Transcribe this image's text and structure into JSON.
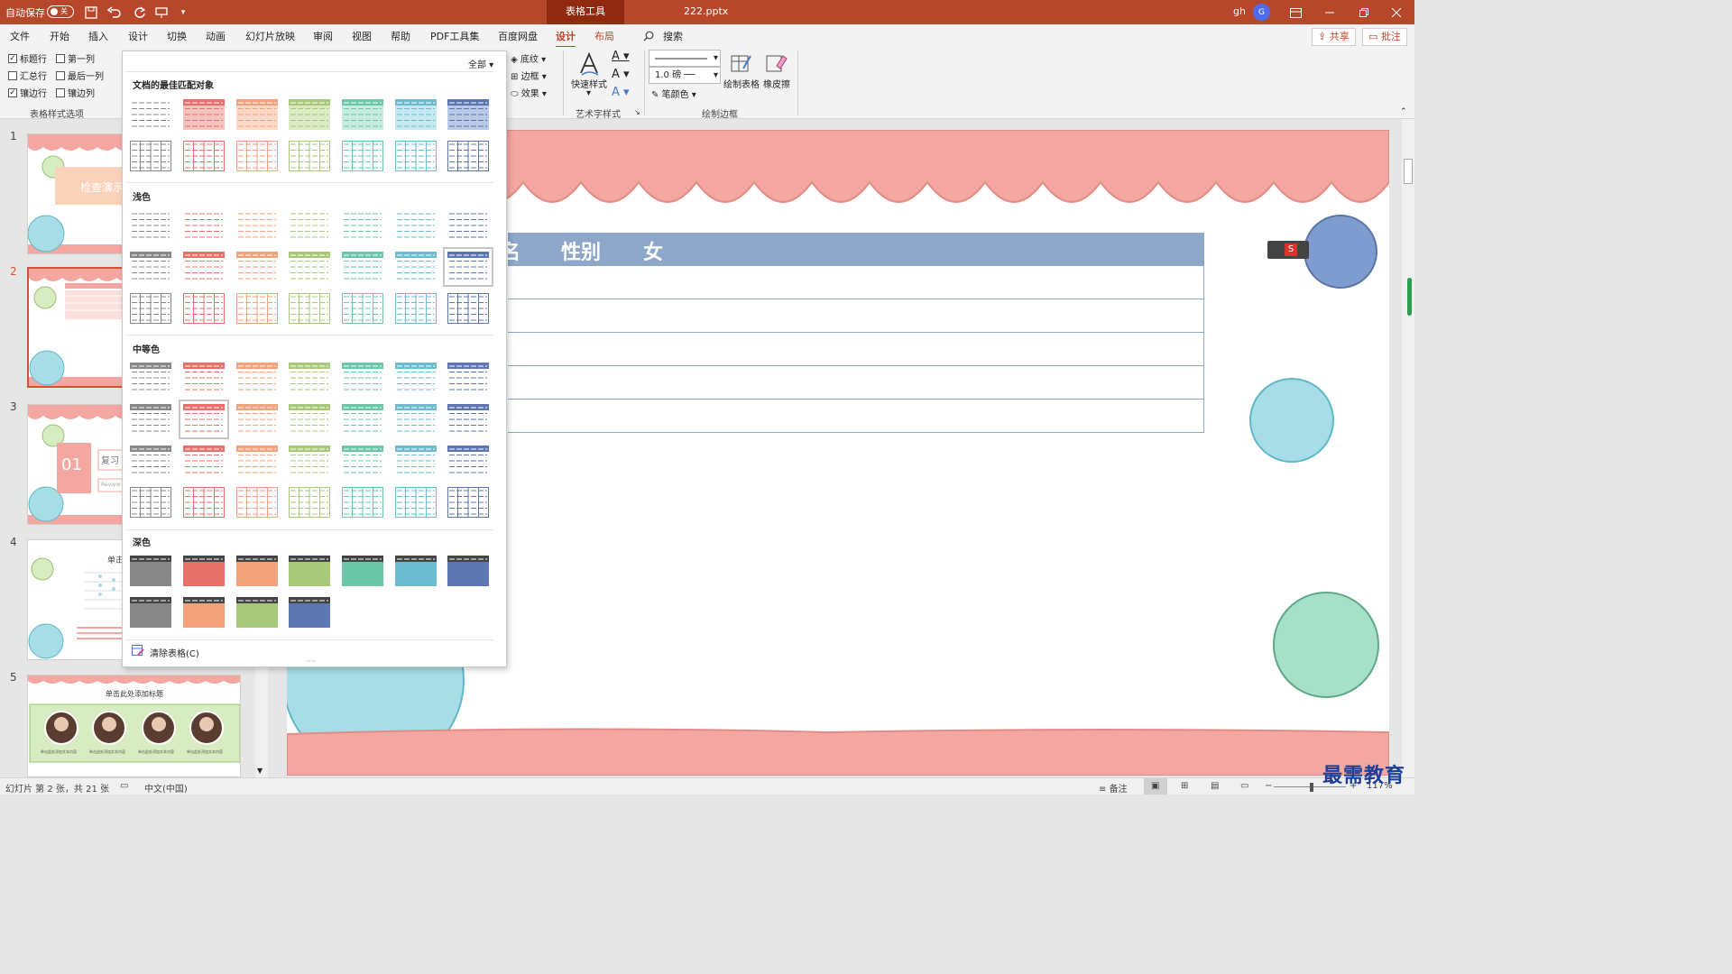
{
  "titlebar": {
    "autosave": "自动保存",
    "toggle": "关",
    "context_tab": "表格工具",
    "filename": "222.pptx",
    "user": "gh",
    "avatar_letter": "G"
  },
  "tabs": [
    {
      "label": "文件"
    },
    {
      "label": "开始"
    },
    {
      "label": "插入"
    },
    {
      "label": "设计"
    },
    {
      "label": "切换"
    },
    {
      "label": "动画"
    },
    {
      "label": "幻灯片放映"
    },
    {
      "label": "审阅"
    },
    {
      "label": "视图"
    },
    {
      "label": "帮助"
    },
    {
      "label": "PDF工具集"
    },
    {
      "label": "百度网盘"
    },
    {
      "label": "设计"
    },
    {
      "label": "布局"
    }
  ],
  "search_label": "搜索",
  "share_label": "共享",
  "comment_label": "批注",
  "ribbon": {
    "options": [
      {
        "label": "标题行",
        "checked": true
      },
      {
        "label": "第一列",
        "checked": false
      },
      {
        "label": "汇总行",
        "checked": false
      },
      {
        "label": "最后一列",
        "checked": false
      },
      {
        "label": "镶边行",
        "checked": true
      },
      {
        "label": "镶边列",
        "checked": false
      }
    ],
    "options_group": "表格样式选项",
    "shading": "底纹",
    "border": "边框",
    "effect": "效果",
    "quick_style": "快速样式",
    "art_group": "艺术字样式",
    "pen_weight": "1.0 磅",
    "pen_color": "笔颜色",
    "draw_table": "绘制表格",
    "eraser": "橡皮擦",
    "draw_group": "绘制边框"
  },
  "gallery": {
    "filter": "全部",
    "sections": [
      "文档的最佳匹配对象",
      "浅色",
      "中等色",
      "深色"
    ],
    "clear": "清除表格(C)"
  },
  "slides": {
    "numbers": [
      "1",
      "2",
      "3",
      "4",
      "5"
    ],
    "s1_title": "检查演示",
    "s3_num": "01",
    "s3_text": "复习",
    "s3_sub": "Review",
    "s4_title": "单击",
    "s5_title": "单击此处添加标题",
    "s5_caption": "单击此处添加文本内容"
  },
  "slide": {
    "header": [
      "名",
      "性别",
      "女"
    ]
  },
  "status": {
    "slide_info": "幻灯片 第 2 张，共 21 张",
    "lang": "中文(中国)",
    "notes": "备注",
    "zoom": "117%"
  },
  "watermark": "最需教育",
  "colors": {
    "accent": "#b7472a",
    "salmon": "#f4a6a0",
    "blue_header": "#8ea6c8",
    "teal": "#a6dde6",
    "green": "#a6e0c8"
  }
}
